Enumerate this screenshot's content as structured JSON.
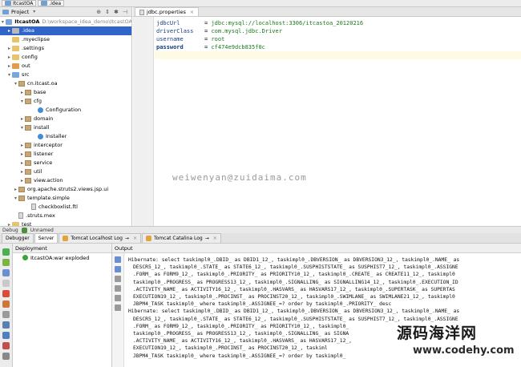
{
  "breadcrumb": {
    "project": "ItcastOA",
    "folder": ".idea"
  },
  "project_panel": {
    "title": "Project",
    "items": [
      {
        "label": "ItcastOA",
        "path": "D:\\workspace_idea_demo\\ItcastOA",
        "bold": true
      },
      {
        "label": ".idea"
      },
      {
        "label": ".myeclipse"
      },
      {
        "label": ".settings"
      },
      {
        "label": "config"
      },
      {
        "label": "out"
      },
      {
        "label": "src"
      },
      {
        "label": "cn.itcast.oa"
      },
      {
        "label": "base"
      },
      {
        "label": "cfg"
      },
      {
        "label": "Configuration"
      },
      {
        "label": "domain"
      },
      {
        "label": "install"
      },
      {
        "label": "Installer"
      },
      {
        "label": "interceptor"
      },
      {
        "label": "listener"
      },
      {
        "label": "service"
      },
      {
        "label": "util"
      },
      {
        "label": "view.action"
      },
      {
        "label": "org.apache.struts2.views.jsp.ui"
      },
      {
        "label": "template.simple"
      },
      {
        "label": "checkboxlist.ftl"
      },
      {
        "label": ".struts.mex"
      },
      {
        "label": "test"
      }
    ]
  },
  "editor": {
    "tab": "jdbc.properties",
    "lines": [
      {
        "key": "jdbcUrl",
        "value": "jdbc:mysql://localhost:3306/itcastoa_20120216"
      },
      {
        "key": "driverClass",
        "value": "com.mysql.jdbc.Driver"
      },
      {
        "key": "username",
        "value": "root"
      },
      {
        "key": "password",
        "value": "cf474e9dcb835f0c"
      }
    ],
    "watermark": "weiwenyan@zuidaima.com"
  },
  "debug": {
    "label": "Debug",
    "config": "Unnamed",
    "tabs": [
      "Debugger",
      "Server",
      "Tomcat Localhost Log",
      "Tomcat Catalina Log"
    ]
  },
  "deployment": {
    "title": "Deployment",
    "item": "ItcastOA:war exploded"
  },
  "output": {
    "title": "Output",
    "lines": [
      {
        "t": "Hibernate: select taskimpl0_.DBID_ as DBID1_12_, taskimpl0_.DBVERSION_ as DBVERSION3_12_, taskimpl0_.NAME_ as",
        "in": false
      },
      {
        "t": "DESCR5_12_, taskimpl0_.STATE_ as STATE6_12_, taskimpl0_.SUSPHISTSTATE_ as SUSPHIST7_12_, taskimpl0_.ASSIGNE",
        "in": true
      },
      {
        "t": ".FORM_ as FORM9_12_, taskimpl0_.PRIORITY_ as PRIORITY10_12_, taskimpl0_.CREATE_ as CREATE11_12_, taskimpl0",
        "in": true
      },
      {
        "t": "taskimpl0_.PROGRESS_ as PROGRESS13_12_, taskimpl0_.SIGNALLING_ as SIGNALLING14_12_, taskimpl0_.EXECUTION_ID",
        "in": true
      },
      {
        "t": ".ACTIVITY_NAME_ as ACTIVITY16_12_, taskimpl0_.HASVARS_ as HASVARS17_12_, taskimpl0_.SUPERTASK_ as SUPERTAS",
        "in": true
      },
      {
        "t": "EXECUTION19_12_, taskimpl0_.PROCINST_ as PROCINST20_12_, taskimpl0_.SWIMLANE_ as SWIMLANE21_12_, taskimpl0",
        "in": true
      },
      {
        "t": "JBPM4_TASK taskimpl0_ where taskimpl0_.ASSIGNEE_=? order by taskimpl0_.PRIORITY_ desc",
        "in": true
      },
      {
        "t": "Hibernate: select taskimpl0_.DBID_ as DBID1_12_, taskimpl0_.DBVERSION_ as DBVERSION3_12_, taskimpl0_.NAME_ as",
        "in": false
      },
      {
        "t": "DESCR5_12_, taskimpl0_.STATE_ as STATE6_12_, taskimpl0_.SUSPHISTSTATE_ as SUSPHIST7_12_, taskimpl0_.ASSIGNE",
        "in": true
      },
      {
        "t": ".FORM_ as FORM9_12_, taskimpl0_.PRIORITY_ as PRIORITY10_12_, taskimpl0_",
        "in": true
      },
      {
        "t": "taskimpl0_.PROGRESS_ as PROGRESS13_12_, taskimpl0_.SIGNALLING_ as SIGNA",
        "in": true
      },
      {
        "t": ".ACTIVITY_NAME_ as ACTIVITY16_12_, taskimpl0_.HASVARS_ as HASVARS17_12_,",
        "in": true
      },
      {
        "t": "EXECUTION19_12_, taskimpl0_.PROCINST_ as PROCINST20_12_, taskiml",
        "in": true
      },
      {
        "t": "JBPM4_TASK taskimpl0_ where taskimpl0_.ASSIGNEE_=? order by taskimpl0_",
        "in": true
      }
    ],
    "watermark_cn": "源码海洋网",
    "watermark_url": "www.codehy.com"
  }
}
